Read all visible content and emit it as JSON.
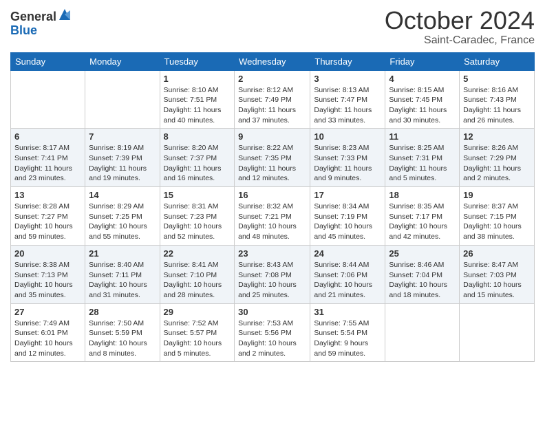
{
  "logo": {
    "general": "General",
    "blue": "Blue"
  },
  "title": "October 2024",
  "subtitle": "Saint-Caradec, France",
  "days_of_week": [
    "Sunday",
    "Monday",
    "Tuesday",
    "Wednesday",
    "Thursday",
    "Friday",
    "Saturday"
  ],
  "weeks": [
    [
      {
        "day": "",
        "info": ""
      },
      {
        "day": "",
        "info": ""
      },
      {
        "day": "1",
        "info": "Sunrise: 8:10 AM\nSunset: 7:51 PM\nDaylight: 11 hours and 40 minutes."
      },
      {
        "day": "2",
        "info": "Sunrise: 8:12 AM\nSunset: 7:49 PM\nDaylight: 11 hours and 37 minutes."
      },
      {
        "day": "3",
        "info": "Sunrise: 8:13 AM\nSunset: 7:47 PM\nDaylight: 11 hours and 33 minutes."
      },
      {
        "day": "4",
        "info": "Sunrise: 8:15 AM\nSunset: 7:45 PM\nDaylight: 11 hours and 30 minutes."
      },
      {
        "day": "5",
        "info": "Sunrise: 8:16 AM\nSunset: 7:43 PM\nDaylight: 11 hours and 26 minutes."
      }
    ],
    [
      {
        "day": "6",
        "info": "Sunrise: 8:17 AM\nSunset: 7:41 PM\nDaylight: 11 hours and 23 minutes."
      },
      {
        "day": "7",
        "info": "Sunrise: 8:19 AM\nSunset: 7:39 PM\nDaylight: 11 hours and 19 minutes."
      },
      {
        "day": "8",
        "info": "Sunrise: 8:20 AM\nSunset: 7:37 PM\nDaylight: 11 hours and 16 minutes."
      },
      {
        "day": "9",
        "info": "Sunrise: 8:22 AM\nSunset: 7:35 PM\nDaylight: 11 hours and 12 minutes."
      },
      {
        "day": "10",
        "info": "Sunrise: 8:23 AM\nSunset: 7:33 PM\nDaylight: 11 hours and 9 minutes."
      },
      {
        "day": "11",
        "info": "Sunrise: 8:25 AM\nSunset: 7:31 PM\nDaylight: 11 hours and 5 minutes."
      },
      {
        "day": "12",
        "info": "Sunrise: 8:26 AM\nSunset: 7:29 PM\nDaylight: 11 hours and 2 minutes."
      }
    ],
    [
      {
        "day": "13",
        "info": "Sunrise: 8:28 AM\nSunset: 7:27 PM\nDaylight: 10 hours and 59 minutes."
      },
      {
        "day": "14",
        "info": "Sunrise: 8:29 AM\nSunset: 7:25 PM\nDaylight: 10 hours and 55 minutes."
      },
      {
        "day": "15",
        "info": "Sunrise: 8:31 AM\nSunset: 7:23 PM\nDaylight: 10 hours and 52 minutes."
      },
      {
        "day": "16",
        "info": "Sunrise: 8:32 AM\nSunset: 7:21 PM\nDaylight: 10 hours and 48 minutes."
      },
      {
        "day": "17",
        "info": "Sunrise: 8:34 AM\nSunset: 7:19 PM\nDaylight: 10 hours and 45 minutes."
      },
      {
        "day": "18",
        "info": "Sunrise: 8:35 AM\nSunset: 7:17 PM\nDaylight: 10 hours and 42 minutes."
      },
      {
        "day": "19",
        "info": "Sunrise: 8:37 AM\nSunset: 7:15 PM\nDaylight: 10 hours and 38 minutes."
      }
    ],
    [
      {
        "day": "20",
        "info": "Sunrise: 8:38 AM\nSunset: 7:13 PM\nDaylight: 10 hours and 35 minutes."
      },
      {
        "day": "21",
        "info": "Sunrise: 8:40 AM\nSunset: 7:11 PM\nDaylight: 10 hours and 31 minutes."
      },
      {
        "day": "22",
        "info": "Sunrise: 8:41 AM\nSunset: 7:10 PM\nDaylight: 10 hours and 28 minutes."
      },
      {
        "day": "23",
        "info": "Sunrise: 8:43 AM\nSunset: 7:08 PM\nDaylight: 10 hours and 25 minutes."
      },
      {
        "day": "24",
        "info": "Sunrise: 8:44 AM\nSunset: 7:06 PM\nDaylight: 10 hours and 21 minutes."
      },
      {
        "day": "25",
        "info": "Sunrise: 8:46 AM\nSunset: 7:04 PM\nDaylight: 10 hours and 18 minutes."
      },
      {
        "day": "26",
        "info": "Sunrise: 8:47 AM\nSunset: 7:03 PM\nDaylight: 10 hours and 15 minutes."
      }
    ],
    [
      {
        "day": "27",
        "info": "Sunrise: 7:49 AM\nSunset: 6:01 PM\nDaylight: 10 hours and 12 minutes."
      },
      {
        "day": "28",
        "info": "Sunrise: 7:50 AM\nSunset: 5:59 PM\nDaylight: 10 hours and 8 minutes."
      },
      {
        "day": "29",
        "info": "Sunrise: 7:52 AM\nSunset: 5:57 PM\nDaylight: 10 hours and 5 minutes."
      },
      {
        "day": "30",
        "info": "Sunrise: 7:53 AM\nSunset: 5:56 PM\nDaylight: 10 hours and 2 minutes."
      },
      {
        "day": "31",
        "info": "Sunrise: 7:55 AM\nSunset: 5:54 PM\nDaylight: 9 hours and 59 minutes."
      },
      {
        "day": "",
        "info": ""
      },
      {
        "day": "",
        "info": ""
      }
    ]
  ]
}
